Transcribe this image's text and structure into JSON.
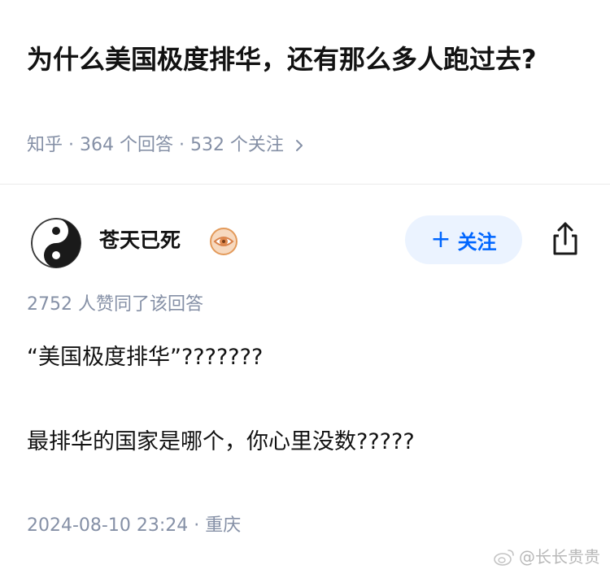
{
  "question": {
    "title": "为什么美国极度排华，还有那么多人跑过去?",
    "meta": "知乎 · 364 个回答 · 532 个关注"
  },
  "author": {
    "name": "苍天已死",
    "avatar": "yin-yang-icon",
    "badge": "eye-badge-icon",
    "follow_label": "关注"
  },
  "answer": {
    "upvote_info": "2752 人赞同了该回答",
    "lines": [
      "“美国极度排华”???????",
      "最排华的国家是哪个，你心里没数?????"
    ],
    "time_location": "2024-08-10 23:24 · 重庆"
  },
  "watermark": "@长长贵贵",
  "colors": {
    "accent": "#0066ff",
    "follow_bg": "#ebf3ff",
    "meta_gray": "#8590a6",
    "badge_orange": "#f0a25a"
  }
}
